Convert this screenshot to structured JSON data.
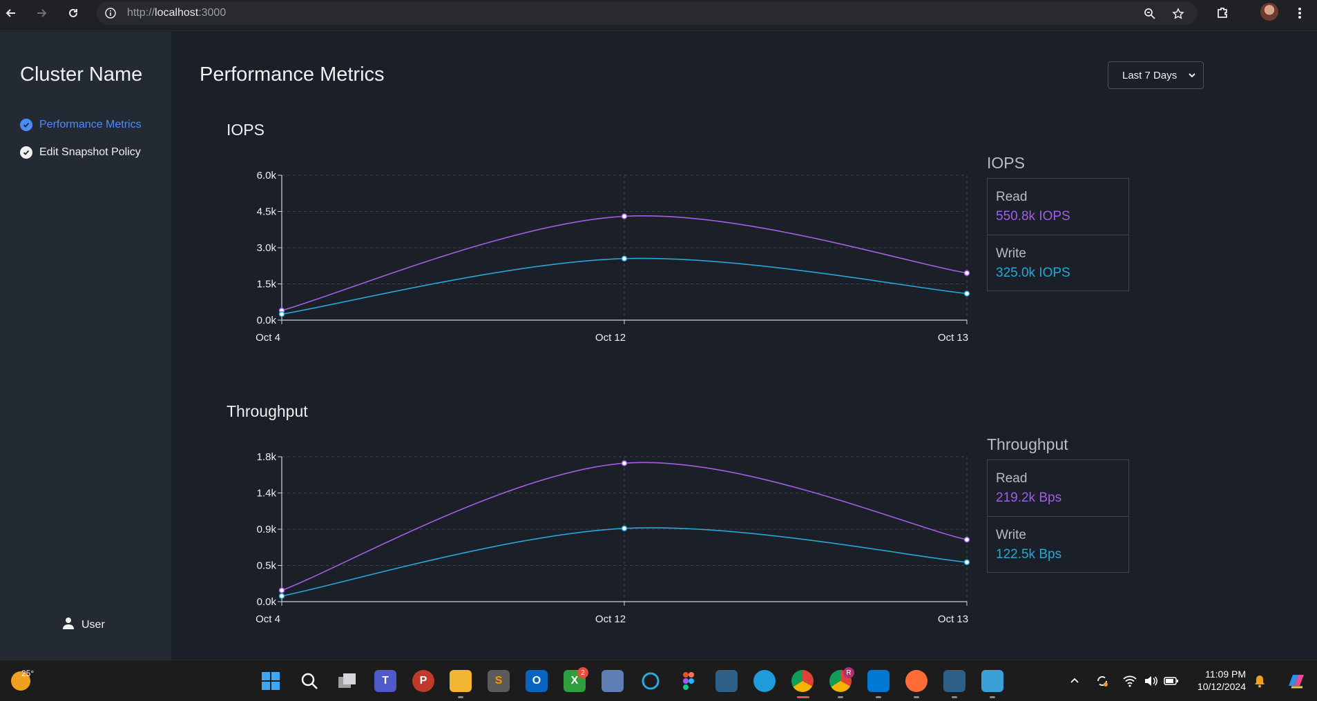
{
  "browser": {
    "url_prefix": "http://",
    "url_host": "localhost",
    "url_port": ":3000"
  },
  "sidebar": {
    "title": "Cluster Name",
    "items": [
      {
        "label": "Performance Metrics",
        "active": true
      },
      {
        "label": "Edit Snapshot Policy",
        "active": false
      }
    ],
    "user_label": "User"
  },
  "main": {
    "title": "Performance Metrics",
    "range_select": {
      "value": "Last 7 Days"
    }
  },
  "colors": {
    "read": "#a35ee8",
    "write": "#27a8d8",
    "accent": "#4b8df8"
  },
  "chart_data": [
    {
      "type": "line",
      "title": "IOPS",
      "categories": [
        "Oct 4",
        "Oct 12",
        "Oct 13"
      ],
      "y_ticks": [
        "0.0k",
        "1.5k",
        "3.0k",
        "4.5k",
        "6.0k"
      ],
      "ylim": [
        0,
        6000
      ],
      "grid": true,
      "series": [
        {
          "key": "read",
          "values": [
            400,
            4300,
            1950
          ]
        },
        {
          "key": "write",
          "values": [
            250,
            2550,
            1100
          ]
        }
      ],
      "summary": {
        "title": "IOPS",
        "read_label": "Read",
        "read_value": "550.8k IOPS",
        "write_label": "Write",
        "write_value": "325.0k IOPS"
      }
    },
    {
      "type": "line",
      "title": "Throughput",
      "categories": [
        "Oct 4",
        "Oct 12",
        "Oct 13"
      ],
      "y_ticks": [
        "0.0k",
        "0.5k",
        "0.9k",
        "1.4k",
        "1.8k"
      ],
      "ylim": [
        0,
        1800
      ],
      "grid": true,
      "series": [
        {
          "key": "read",
          "values": [
            140,
            1720,
            770
          ]
        },
        {
          "key": "write",
          "values": [
            70,
            910,
            490
          ]
        }
      ],
      "summary": {
        "title": "Throughput",
        "read_label": "Read",
        "read_value": "219.2k Bps",
        "write_label": "Write",
        "write_value": "122.5k Bps"
      }
    }
  ],
  "taskbar": {
    "temperature": "25°",
    "time": "11:09 PM",
    "date": "10/12/2024",
    "xbox_badge": "2",
    "chrome_profile_badge": "R",
    "apps": [
      "windows-start",
      "search",
      "task-view",
      "teams",
      "psiphon",
      "file-explorer",
      "sublime-text",
      "outlook",
      "xbox",
      "performance-monitor",
      "cortana",
      "figma",
      "mysql-workbench",
      "edge",
      "chrome",
      "chrome-profile",
      "vscode",
      "postman",
      "mysql-workbench-2",
      "notepad"
    ]
  }
}
